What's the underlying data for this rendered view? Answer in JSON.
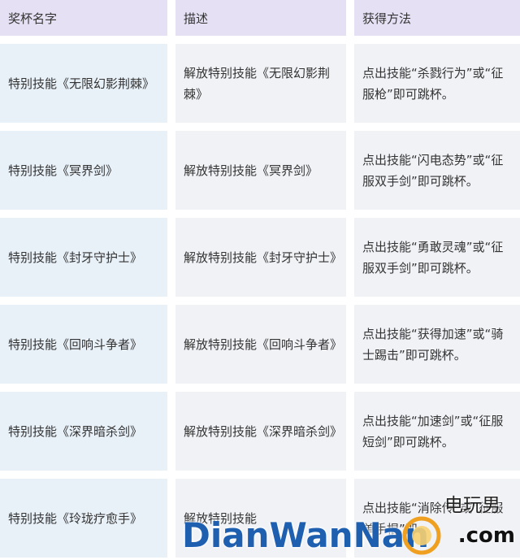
{
  "table": {
    "headers": [
      "奖杯名字",
      "描述",
      "获得方法"
    ],
    "rows": [
      [
        "特别技能《无限幻影荆棘》",
        "解放特别技能《无限幻影荆棘》",
        "点出技能“杀戮行为”或“征服枪”即可跳杯。"
      ],
      [
        "特别技能《冥界剑》",
        "解放特别技能《冥界剑》",
        "点出技能“闪电态势”或“征服双手剑”即可跳杯。"
      ],
      [
        "特别技能《封牙守护士》",
        "解放特别技能《封牙守护士》",
        "点出技能“勇敢灵魂”或“征服双手剑”即可跳杯。"
      ],
      [
        "特别技能《回响斗争者》",
        "解放特别技能《回响斗争者》",
        "点出技能“获得加速”或“骑士踢击”即可跳杯。"
      ],
      [
        "特别技能《深界暗杀剑》",
        "解放特别技能《深界暗杀剑》",
        "点出技能“加速剑”或“征服短剑”即可跳杯。"
      ],
      [
        "特别技能《玲珑疗愈手》",
        "解放特别技能",
        "点出技能“消除传”或“征服单手棍”即"
      ]
    ]
  },
  "watermark": {
    "brand": "DianWanNan",
    "cn": "电玩男",
    "domain_suffix": ".com"
  },
  "colors": {
    "header_bg": "#e6e0f4",
    "name_col_bg": "#e8f0f8",
    "cell_bg": "#f0f2f6",
    "watermark_blue": "#1f5fb0"
  }
}
